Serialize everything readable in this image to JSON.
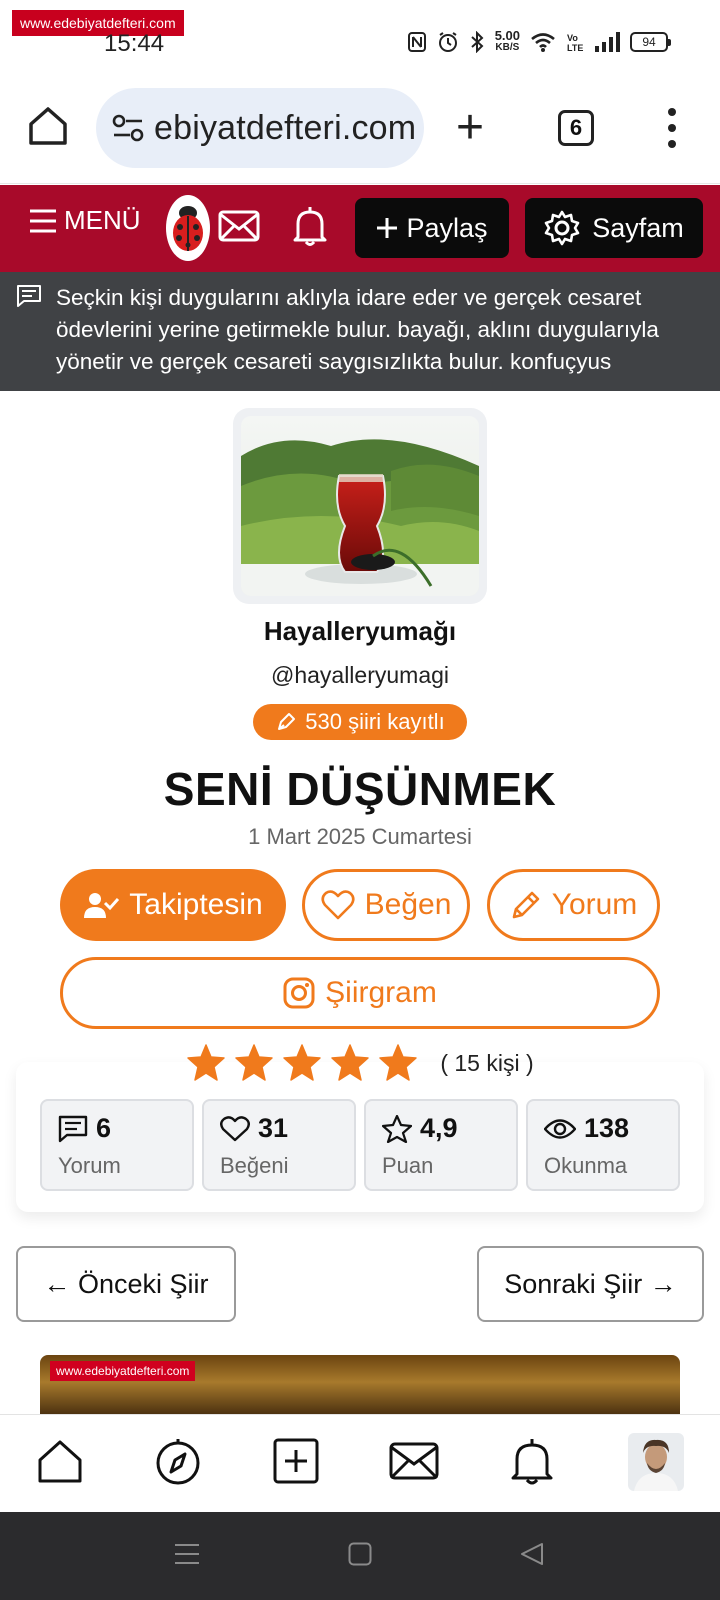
{
  "status_bar": {
    "watermark": "www.edebiyatdefteri.com",
    "time": "15:44",
    "net_speed_value": "5.00",
    "net_speed_unit": "KB/S",
    "network_label": "Vo LTE",
    "battery": "94"
  },
  "browser": {
    "url": "ebiyatdefteri.com",
    "tab_count": "6"
  },
  "header": {
    "menu_label": "MENÜ",
    "share_label": "Paylaş",
    "mypage_label": "Sayfam",
    "bg_color": "#a80a2a"
  },
  "quote": {
    "text": "Seçkin kişi duygularını aklıyla idare eder ve gerçek cesaret ödevlerini yerine getirmekle bulur. bayağı, aklını duygularıyla yönetir ve gerçek cesareti saygısızlıkta bulur. konfuçyus"
  },
  "author": {
    "name": "Hayalleryumağı",
    "handle": "@hayalleryumagi",
    "poem_count_label": "530 şiiri kayıtlı"
  },
  "poem": {
    "title": "SENİ DÜŞÜNMEK",
    "date": "1 Mart 2025 Cumartesi"
  },
  "actions": {
    "follow_label": "Takiptesin",
    "like_label": "Beğen",
    "comment_label": "Yorum",
    "siirgram_label": "Şiirgram",
    "accent_color": "#f07a1c"
  },
  "rating": {
    "stars_filled": 5,
    "stars_total": 5,
    "voter_label": "( 15 kişi )"
  },
  "stats": [
    {
      "value": "6",
      "label": "Yorum",
      "icon": "comment-icon"
    },
    {
      "value": "31",
      "label": "Beğeni",
      "icon": "heart-icon"
    },
    {
      "value": "4,9",
      "label": "Puan",
      "icon": "star-icon"
    },
    {
      "value": "138",
      "label": "Okunma",
      "icon": "eye-icon"
    }
  ],
  "navigation": {
    "prev_label": "← Önceki Şiir",
    "next_label": "Sonraki Şiir →"
  },
  "preview": {
    "watermark": "www.edebiyatdefteri.com"
  }
}
